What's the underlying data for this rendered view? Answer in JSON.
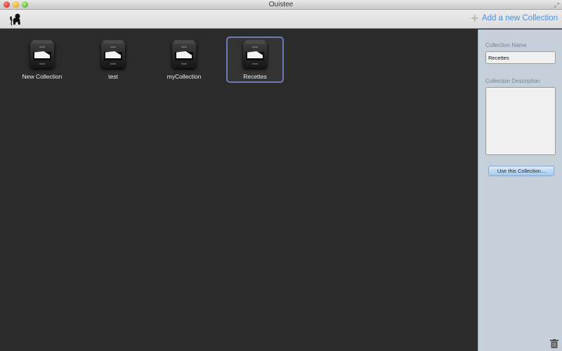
{
  "window": {
    "title": "Ouistee"
  },
  "toolbar": {
    "logo_icon": "monkey-icon",
    "add_button": {
      "icon": "plus-icon",
      "label": "Add a new Collection"
    }
  },
  "collections": [
    {
      "name": "New Collection",
      "icon": "file-cabinet-icon",
      "selected": false
    },
    {
      "name": "test",
      "icon": "file-cabinet-icon",
      "selected": false
    },
    {
      "name": "myCollection",
      "icon": "file-cabinet-icon",
      "selected": false
    },
    {
      "name": "Recettes",
      "icon": "file-cabinet-icon",
      "selected": true
    }
  ],
  "sidebar": {
    "name_label": "Collection Name",
    "name_value": "Recettes",
    "description_label": "Collection Description",
    "description_value": "",
    "use_button": "Use this Collection...",
    "trash_icon": "trash-icon"
  },
  "colors": {
    "accent": "#4a8fe0",
    "selection_border": "#6c7ab8",
    "main_background": "#2b2b2b",
    "sidebar_background": "#c6d0da"
  }
}
